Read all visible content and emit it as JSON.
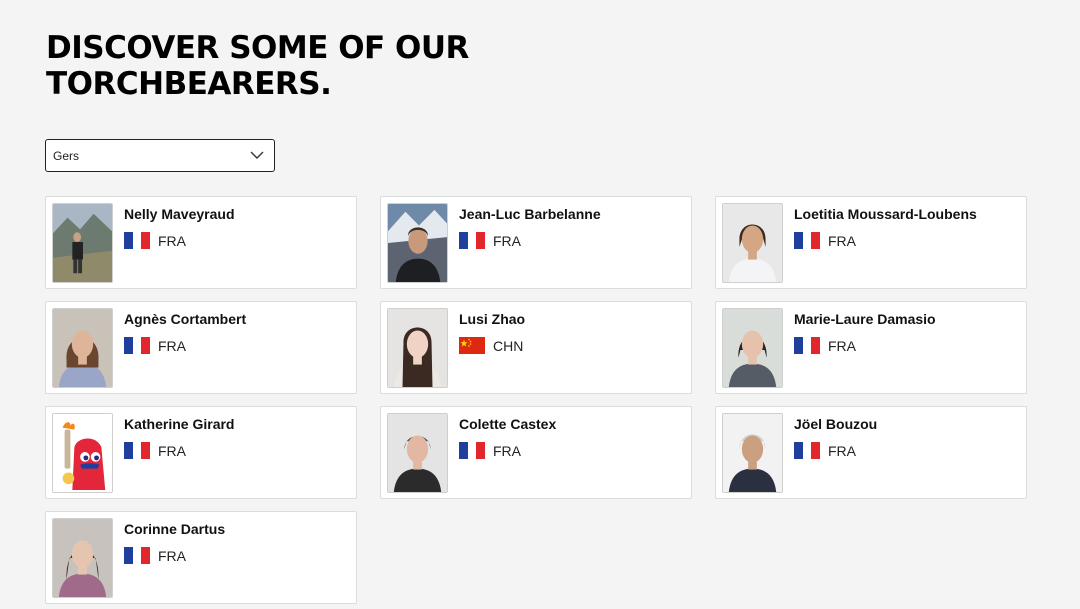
{
  "heading": {
    "line1": "DISCOVER SOME OF OUR",
    "line2": "TORCHBEARERS."
  },
  "filter": {
    "selected": "Gers",
    "icon": "chevron-down-icon"
  },
  "flags": {
    "FRA": {
      "colors": [
        "#1f3f9f",
        "#ffffff",
        "#e1262d"
      ]
    },
    "CHN": {
      "colors": [
        "#de2910",
        "#ffde00"
      ]
    }
  },
  "torchbearers": [
    {
      "name": "Nelly Maveyraud",
      "country": "FRA",
      "photo": "landscape-person"
    },
    {
      "name": "Jean-Luc Barbelanne",
      "country": "FRA",
      "photo": "mountain-person"
    },
    {
      "name": "Loetitia Moussard-Loubens",
      "country": "FRA",
      "photo": "light-portrait"
    },
    {
      "name": "Agnès Cortambert",
      "country": "FRA",
      "photo": "portrait-glasses"
    },
    {
      "name": "Lusi Zhao",
      "country": "CHN",
      "photo": "portrait-long-hair"
    },
    {
      "name": "Marie-Laure Damasio",
      "country": "FRA",
      "photo": "portrait-dark-hair"
    },
    {
      "name": "Katherine Girard",
      "country": "FRA",
      "photo": "mascot"
    },
    {
      "name": "Colette Castex",
      "country": "FRA",
      "photo": "portrait-short-hair"
    },
    {
      "name": "Jöel Bouzou",
      "country": "FRA",
      "photo": "portrait-grey-hair"
    },
    {
      "name": "Corinne Dartus",
      "country": "FRA",
      "photo": "portrait-brown-hair"
    }
  ]
}
